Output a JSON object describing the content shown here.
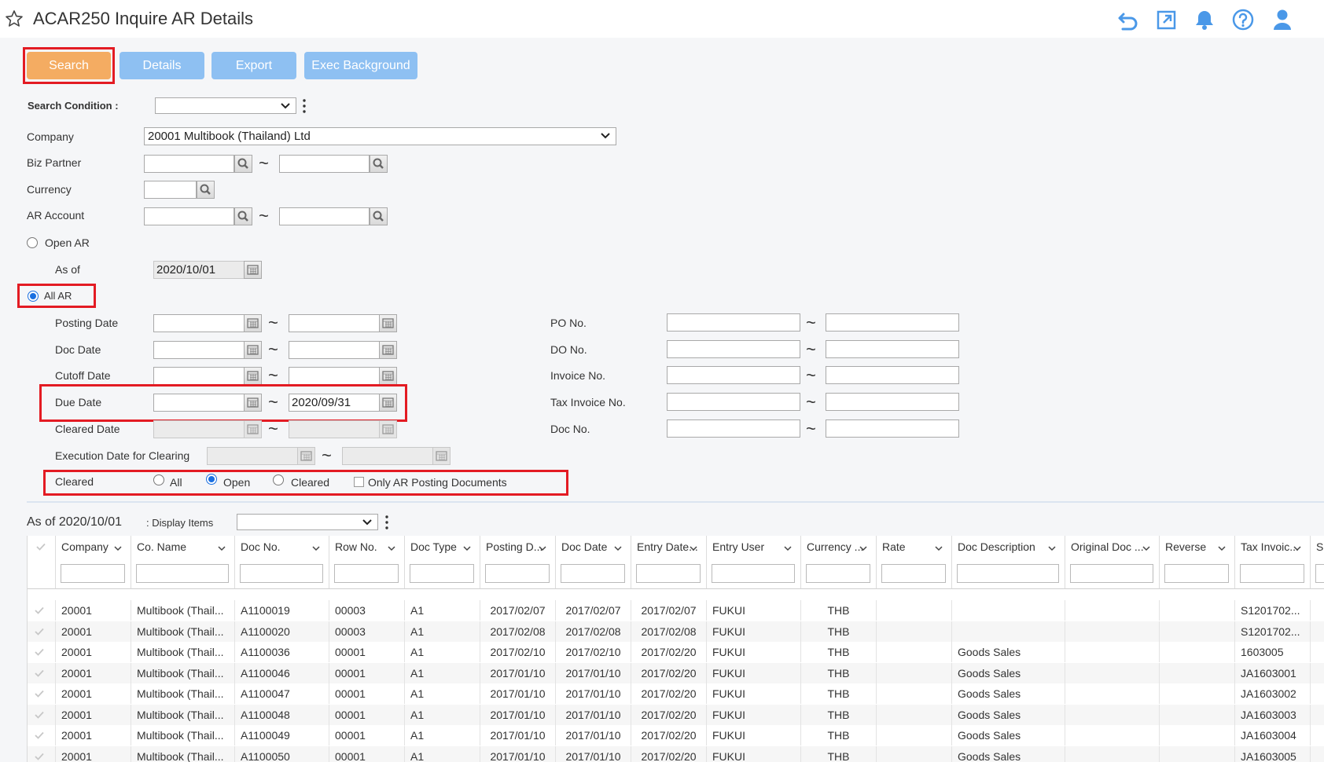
{
  "header": {
    "title": "ACAR250 Inquire AR Details",
    "icons": [
      "star-icon",
      "undo-icon",
      "external-link-icon",
      "bell-icon",
      "help-icon",
      "user-icon"
    ]
  },
  "toolbar": {
    "search_label": "Search",
    "details_label": "Details",
    "export_label": "Export",
    "exec_background_label": "Exec Background"
  },
  "form": {
    "search_condition_label": "Search Condition :",
    "search_condition_value": "",
    "company_label": "Company",
    "company_value": "20001 Multibook (Thailand) Ltd",
    "biz_partner_label": "Biz Partner",
    "currency_label": "Currency",
    "ar_account_label": "AR Account",
    "open_ar_label": "Open AR",
    "as_of_label": "As of",
    "as_of_value": "2020/10/01",
    "all_ar_label": "All AR",
    "posting_date_label": "Posting Date",
    "doc_date_label": "Doc Date",
    "cutoff_date_label": "Cutoff Date",
    "due_date_label": "Due Date",
    "due_date_to_value": "2020/09/31",
    "cleared_date_label": "Cleared Date",
    "exec_date_clearing_label": "Execution Date for Clearing",
    "cleared_label": "Cleared",
    "cleared_options": {
      "all": "All",
      "open": "Open",
      "cleared": "Cleared",
      "only_ar": "Only AR Posting Documents"
    },
    "po_no_label": "PO No.",
    "do_no_label": "DO No.",
    "invoice_no_label": "Invoice No.",
    "tax_invoice_no_label": "Tax Invoice No.",
    "doc_no_label": "Doc No.",
    "tilde": "~"
  },
  "results": {
    "as_of_text": "As of 2020/10/01",
    "display_items_label": ": Display Items",
    "columns": [
      "Company",
      "Co. Name",
      "Doc No.",
      "Row No.",
      "Doc Type",
      "Posting D...",
      "Doc Date",
      "Entry Date...",
      "Entry User",
      "Currency ...",
      "Rate",
      "Doc Description",
      "Original Doc ...",
      "Reverse",
      "Tax Invoic...",
      "Sp"
    ],
    "rows": [
      [
        "20001",
        "Multibook (Thail...",
        "A1100019",
        "00003",
        "A1",
        "2017/02/07",
        "2017/02/07",
        "2017/02/07",
        "FUKUI",
        "THB",
        "",
        "",
        "",
        "",
        "S1201702..."
      ],
      [
        "20001",
        "Multibook (Thail...",
        "A1100020",
        "00003",
        "A1",
        "2017/02/08",
        "2017/02/08",
        "2017/02/08",
        "FUKUI",
        "THB",
        "",
        "",
        "",
        "",
        "S1201702..."
      ],
      [
        "20001",
        "Multibook (Thail...",
        "A1100036",
        "00001",
        "A1",
        "2017/02/10",
        "2017/02/10",
        "2017/02/20",
        "FUKUI",
        "THB",
        "",
        "Goods Sales",
        "",
        "",
        "1603005"
      ],
      [
        "20001",
        "Multibook (Thail...",
        "A1100046",
        "00001",
        "A1",
        "2017/01/10",
        "2017/01/10",
        "2017/02/20",
        "FUKUI",
        "THB",
        "",
        "Goods Sales",
        "",
        "",
        "JA1603001"
      ],
      [
        "20001",
        "Multibook (Thail...",
        "A1100047",
        "00001",
        "A1",
        "2017/01/10",
        "2017/01/10",
        "2017/02/20",
        "FUKUI",
        "THB",
        "",
        "Goods Sales",
        "",
        "",
        "JA1603002"
      ],
      [
        "20001",
        "Multibook (Thail...",
        "A1100048",
        "00001",
        "A1",
        "2017/01/10",
        "2017/01/10",
        "2017/02/20",
        "FUKUI",
        "THB",
        "",
        "Goods Sales",
        "",
        "",
        "JA1603003"
      ],
      [
        "20001",
        "Multibook (Thail...",
        "A1100049",
        "00001",
        "A1",
        "2017/01/10",
        "2017/01/10",
        "2017/02/20",
        "FUKUI",
        "THB",
        "",
        "Goods Sales",
        "",
        "",
        "JA1603004"
      ],
      [
        "20001",
        "Multibook (Thail...",
        "A1100050",
        "00001",
        "A1",
        "2017/01/10",
        "2017/01/10",
        "2017/02/20",
        "FUKUI",
        "THB",
        "",
        "Goods Sales",
        "",
        "",
        "JA1603005"
      ]
    ]
  },
  "colors": {
    "primary_button": "#8ec0f2",
    "search_button": "#f4ac62",
    "highlight": "#e31b23",
    "icon_blue": "#4a98e8"
  }
}
